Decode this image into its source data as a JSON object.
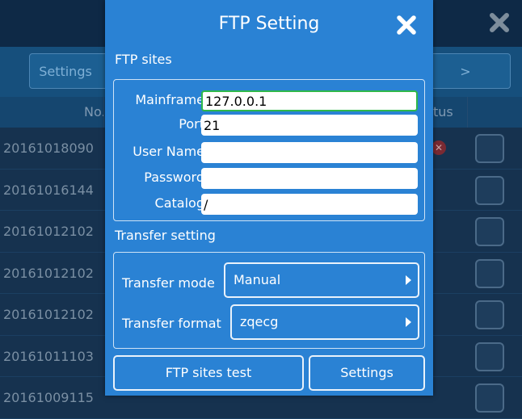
{
  "background": {
    "top_close_icon": "close-icon",
    "toolbar": {
      "settings_label": "Settings",
      "next_label": ">"
    },
    "table": {
      "headers": {
        "no": "No.",
        "status": "tus"
      },
      "rows": [
        {
          "no": "20161018090",
          "status": "error"
        },
        {
          "no": "20161016144",
          "status": ""
        },
        {
          "no": "20161012102",
          "status": ""
        },
        {
          "no": "20161012102",
          "status": ""
        },
        {
          "no": "20161012102",
          "status": ""
        },
        {
          "no": "20161011103",
          "status": ""
        },
        {
          "no": "20161009115",
          "status": ""
        }
      ]
    }
  },
  "dialog": {
    "title": "FTP Setting",
    "close_icon": "close-icon",
    "ftp_sites": {
      "section_label": "FTP sites",
      "fields": {
        "mainframe": {
          "label": "Mainframe",
          "value": "127.0.0.1"
        },
        "port": {
          "label": "Port",
          "value": "21"
        },
        "user_name": {
          "label": "User Name",
          "value": ""
        },
        "password": {
          "label": "Password",
          "value": ""
        },
        "catalog": {
          "label": "Catalog",
          "value": "/"
        }
      }
    },
    "transfer": {
      "section_label": "Transfer setting",
      "mode": {
        "label": "Transfer mode",
        "value": "Manual"
      },
      "format": {
        "label": "Transfer format",
        "value": "zqecg"
      }
    },
    "buttons": {
      "test": "FTP sites test",
      "settings": "Settings"
    }
  },
  "colors": {
    "dialog_bg": "#2a82d4",
    "focus_border": "#2fb84a",
    "background_dim": "#0d2a47"
  }
}
